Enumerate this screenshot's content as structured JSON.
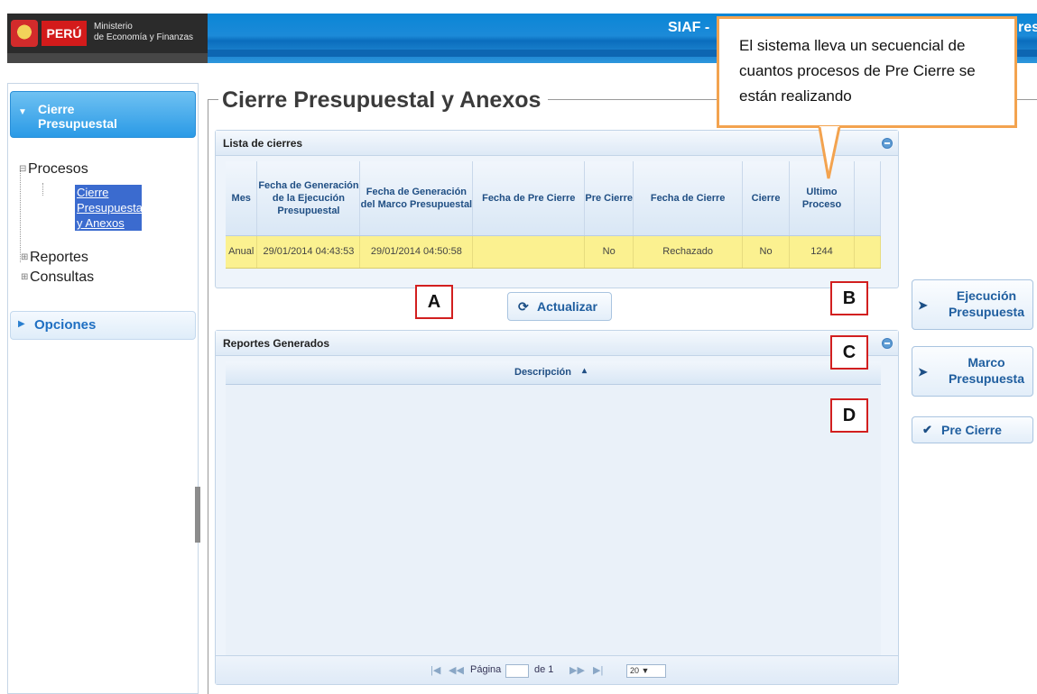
{
  "header": {
    "logo_peru": "PERÚ",
    "logo_ministry_line1": "Ministerio",
    "logo_ministry_line2": "de Economía y Finanzas",
    "app_title": "SIAF -",
    "app_title_right": "res"
  },
  "sidebar": {
    "section_title_line1": "Cierre",
    "section_title_line2": "Presupuestal",
    "tree": {
      "procesos": "Procesos",
      "selected_line1": "Cierre",
      "selected_line2": "Presupuestal",
      "selected_line3": "y Anexos",
      "reportes": "Reportes",
      "consultas": "Consultas"
    },
    "opciones": "Opciones"
  },
  "main": {
    "title": "Cierre Presupuestal y Anexos",
    "lista": {
      "title": "Lista de cierres",
      "columns": [
        "Mes",
        "Fecha de Generación de la Ejecución Presupuestal",
        "Fecha de Generación del Marco Presupuestal",
        "Fecha de Pre Cierre",
        "Pre Cierre",
        "Fecha de Cierre",
        "Cierre",
        "Ultimo Proceso"
      ],
      "rows": [
        {
          "mes": "Anual",
          "fecha_ejecucion": "29/01/2014 04:43:53",
          "fecha_marco": "29/01/2014 04:50:58",
          "fecha_precierre": "",
          "precierre": "No",
          "fecha_cierre": "Rechazado",
          "cierre": "No",
          "ultimo_proceso": "1244"
        }
      ]
    },
    "actualizar_label": "Actualizar",
    "reportes": {
      "title": "Reportes Generados",
      "column": "Descripción",
      "pager_page_label": "Página",
      "pager_of_label": "de 1",
      "pager_size": "20"
    },
    "side_buttons": {
      "ejecucion": "Ejecución Presupuesta",
      "marco": "Marco Presupuesta",
      "precierre": "Pre Cierre"
    }
  },
  "annotations": {
    "A": "A",
    "B": "B",
    "C": "C",
    "D": "D",
    "callout": "El sistema lleva un secuencial de cuantos procesos  de Pre Cierre se están realizando"
  },
  "colors": {
    "header_blue": "#1c8ad8",
    "selected_row": "#fbf190",
    "annotation_red": "#d21f1f",
    "callout_orange": "#f3a34f"
  }
}
